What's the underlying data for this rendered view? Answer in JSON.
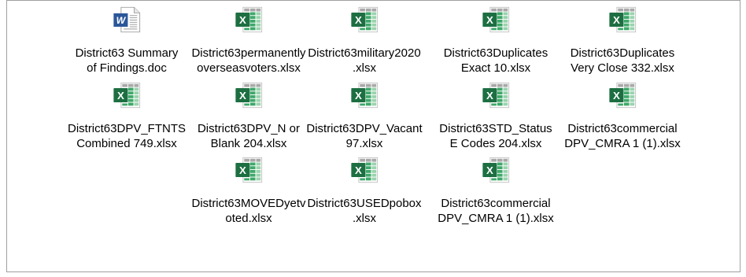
{
  "files": [
    {
      "icon": "word-file-icon",
      "lines": [
        "District63 Summary",
        "of Findings.doc"
      ]
    },
    {
      "icon": "excel-file-icon",
      "lines": [
        "District63permanently",
        "overseasvoters.xlsx"
      ]
    },
    {
      "icon": "excel-file-icon",
      "lines": [
        "District63military2020",
        ".xlsx"
      ]
    },
    {
      "icon": "excel-file-icon",
      "lines": [
        "District63Duplicates",
        "Exact 10.xlsx"
      ]
    },
    {
      "icon": "excel-file-icon",
      "lines": [
        "District63Duplicates",
        "Very Close 332.xlsx"
      ]
    },
    {
      "icon": "excel-file-icon",
      "lines": [
        "District63DPV_FTNTS",
        "Combined 749.xlsx"
      ]
    },
    {
      "icon": "excel-file-icon",
      "lines": [
        "District63DPV_N or",
        "Blank 204.xlsx"
      ]
    },
    {
      "icon": "excel-file-icon",
      "lines": [
        "District63DPV_Vacant",
        "97.xlsx"
      ]
    },
    {
      "icon": "excel-file-icon",
      "lines": [
        "District63STD_Status",
        "E Codes 204.xlsx"
      ]
    },
    {
      "icon": "excel-file-icon",
      "lines": [
        "District63commercial",
        "DPV_CMRA 1 (1).xlsx"
      ]
    },
    {
      "icon": "excel-file-icon",
      "lines": [
        "District63MOVEDyetv",
        "oted.xlsx"
      ]
    },
    {
      "icon": "excel-file-icon",
      "lines": [
        "District63USEDpobox",
        ".xlsx"
      ]
    },
    {
      "icon": "excel-file-icon",
      "lines": [
        "District63commercial",
        "DPV_CMRA 1 (1).xlsx"
      ]
    }
  ],
  "icons": {
    "word-file-icon": {
      "letter": "W",
      "color": "#2b579a"
    },
    "excel-file-icon": {
      "letter": "X",
      "color": "#1d6f42"
    }
  }
}
